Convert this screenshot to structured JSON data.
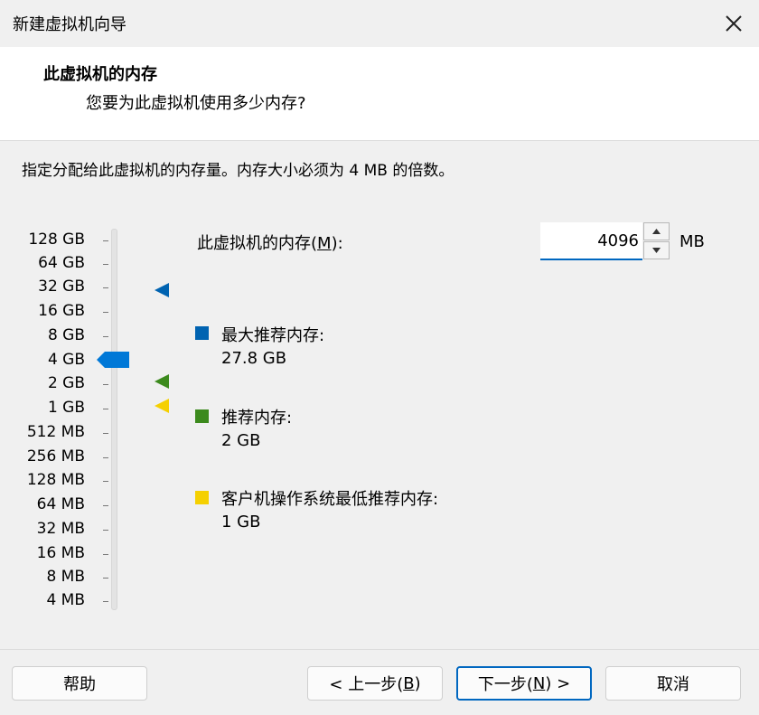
{
  "window": {
    "title": "新建虚拟机向导",
    "close_icon": "close-icon"
  },
  "header": {
    "title": "此虚拟机的内存",
    "subtitle": "您要为此虚拟机使用多少内存?"
  },
  "instruction": "指定分配给此虚拟机的内存量。内存大小必须为 4 MB 的倍数。",
  "scale": {
    "labels": [
      "128 GB",
      "64 GB",
      "32 GB",
      "16 GB",
      "8 GB",
      "4 GB",
      "2 GB",
      "1 GB",
      "512 MB",
      "256 MB",
      "128 MB",
      "64 MB",
      "32 MB",
      "16 MB",
      "8 MB",
      "4 MB"
    ],
    "selected": "4 GB"
  },
  "memory": {
    "label_prefix": "此虚拟机的内存(",
    "label_key": "M",
    "label_suffix": "):",
    "value": "4096",
    "unit": "MB"
  },
  "legend": {
    "max": {
      "label": "最大推荐内存:",
      "value": "27.8 GB",
      "color": "#0063b1"
    },
    "recommended": {
      "label": "推荐内存:",
      "value": "2 GB",
      "color": "#3c8a1d"
    },
    "minimum": {
      "label": "客户机操作系统最低推荐内存:",
      "value": "1 GB",
      "color": "#f5d000"
    }
  },
  "buttons": {
    "help": "帮助",
    "back_prefix": "< 上一步(",
    "back_key": "B",
    "back_suffix": ")",
    "next_prefix": "下一步(",
    "next_key": "N",
    "next_suffix": ") >",
    "cancel": "取消"
  },
  "colors": {
    "accent": "#0067c0",
    "thumb": "#0078d7"
  }
}
